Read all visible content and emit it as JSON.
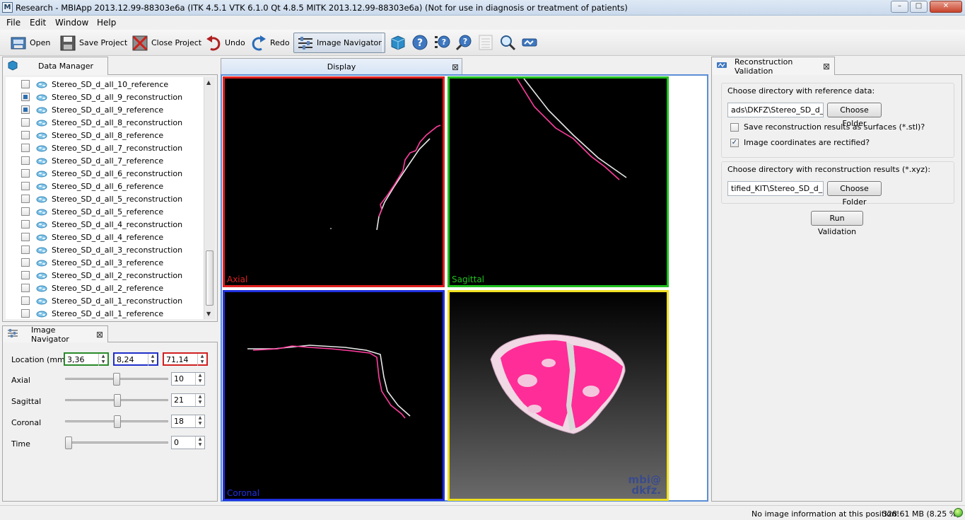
{
  "window": {
    "title": "Research - MBIApp 2013.12.99-88303e6a (ITK 4.5.1  VTK 6.1.0 Qt 4.8.5 MITK 2013.12.99-88303e6a) (Not for use in diagnosis or treatment of patients)",
    "app_icon": "M",
    "minimize_label": "–",
    "maximize_label": "□",
    "close_label": "✕"
  },
  "menu": [
    "File",
    "Edit",
    "Window",
    "Help"
  ],
  "toolbar": {
    "open": "Open",
    "save_project": "Save Project",
    "close_project": "Close Project",
    "undo": "Undo",
    "redo": "Redo",
    "image_navigator": "Image Navigator"
  },
  "data_manager": {
    "tab_label": "Data Manager",
    "items": [
      {
        "label": "Stereo_SD_d_all_10_reference",
        "checked": false
      },
      {
        "label": "Stereo_SD_d_all_9_reconstruction",
        "checked": true
      },
      {
        "label": "Stereo_SD_d_all_9_reference",
        "checked": true
      },
      {
        "label": "Stereo_SD_d_all_8_reconstruction",
        "checked": false
      },
      {
        "label": "Stereo_SD_d_all_8_reference",
        "checked": false
      },
      {
        "label": "Stereo_SD_d_all_7_reconstruction",
        "checked": false
      },
      {
        "label": "Stereo_SD_d_all_7_reference",
        "checked": false
      },
      {
        "label": "Stereo_SD_d_all_6_reconstruction",
        "checked": false
      },
      {
        "label": "Stereo_SD_d_all_6_reference",
        "checked": false
      },
      {
        "label": "Stereo_SD_d_all_5_reconstruction",
        "checked": false
      },
      {
        "label": "Stereo_SD_d_all_5_reference",
        "checked": false
      },
      {
        "label": "Stereo_SD_d_all_4_reconstruction",
        "checked": false
      },
      {
        "label": "Stereo_SD_d_all_4_reference",
        "checked": false
      },
      {
        "label": "Stereo_SD_d_all_3_reconstruction",
        "checked": false
      },
      {
        "label": "Stereo_SD_d_all_3_reference",
        "checked": false
      },
      {
        "label": "Stereo_SD_d_all_2_reconstruction",
        "checked": false
      },
      {
        "label": "Stereo_SD_d_all_2_reference",
        "checked": false
      },
      {
        "label": "Stereo_SD_d_all_1_reconstruction",
        "checked": false
      },
      {
        "label": "Stereo_SD_d_all_1_reference",
        "checked": false
      }
    ]
  },
  "image_navigator": {
    "tab_label": "Image Navigator",
    "location_label": "Location (mm)",
    "location": [
      "3,36",
      "8,24",
      "71,14"
    ],
    "location_colors": [
      "#2a8a2a",
      "#2030c8",
      "#d02020"
    ],
    "sliders": [
      {
        "label": "Axial",
        "value": "10",
        "fraction": 0.5
      },
      {
        "label": "Sagittal",
        "value": "21",
        "fraction": 0.505
      },
      {
        "label": "Coronal",
        "value": "18",
        "fraction": 0.505
      },
      {
        "label": "Time",
        "value": "0",
        "fraction": 0.0
      }
    ]
  },
  "display": {
    "tab_label": "Display",
    "views": {
      "axial": {
        "label": "Axial",
        "color": "#e02020"
      },
      "sagittal": {
        "label": "Sagittal",
        "color": "#20c020"
      },
      "coronal": {
        "label": "Coronal",
        "color": "#2030e0"
      },
      "3d": {
        "label": "",
        "color": "#f0e020"
      }
    },
    "watermark_line1": "mbi@",
    "watermark_line2": "dkfz."
  },
  "reconstruction_validation": {
    "tab_label": "Reconstruction Validation",
    "reference_group_title": "Choose directory with reference data:",
    "reference_path": "ads\\DKFZ\\Stereo_SD_d_all",
    "choose_folder_1": "Choose Folder",
    "save_surfaces_label": "Save reconstruction results as surfaces (*.stl)?",
    "save_surfaces_checked": false,
    "rectified_label": "Image coordinates are rectified?",
    "rectified_checked": true,
    "results_group_title": "Choose directory with reconstruction results (*.xyz):",
    "results_path": "tified_KIT\\Stereo_SD_d_all",
    "choose_folder_2": "Choose Folder",
    "run_button": "Run Validation"
  },
  "status": {
    "message": "No image information at this position!",
    "memory": "328.61 MB (8.25 %)"
  }
}
